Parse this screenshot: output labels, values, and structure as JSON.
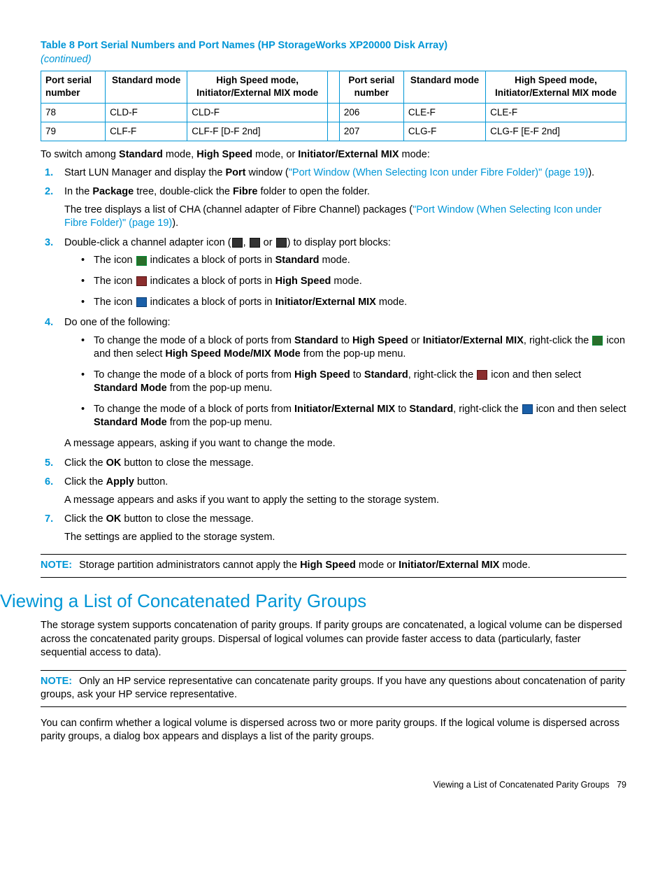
{
  "table": {
    "title": "Table 8 Port Serial Numbers and Port Names (HP StorageWorks XP20000 Disk Array)",
    "continued": "(continued)",
    "headers": {
      "h1": "Port serial number",
      "h2": "Standard mode",
      "h3": "High Speed mode, Initiator/External MIX mode",
      "h4": "Port serial number",
      "h5": "Standard mode",
      "h6": "High Speed mode, Initiator/External MIX mode"
    },
    "rows": [
      {
        "a": "78",
        "b": "CLD-F",
        "c": "CLD-F",
        "d": "206",
        "e": "CLE-F",
        "f": "CLE-F"
      },
      {
        "a": "79",
        "b": "CLF-F",
        "c": "CLF-F [D-F 2nd]",
        "d": "207",
        "e": "CLG-F",
        "f": "CLG-F [E-F 2nd]"
      }
    ]
  },
  "intro": {
    "pre": "To switch among ",
    "b1": "Standard",
    "t1": " mode, ",
    "b2": "High Speed",
    "t2": " mode, or ",
    "b3": "Initiator/External MIX",
    "t3": " mode:"
  },
  "step1": {
    "pre": "Start LUN Manager and display the ",
    "b1": "Port",
    "t1": " window (",
    "link": "\"Port Window (When Selecting Icon under Fibre Folder)\" (page 19)",
    "t2": ")."
  },
  "step2": {
    "a_pre": "In the ",
    "a_b1": "Package",
    "a_t1": " tree, double-click the ",
    "a_b2": "Fibre",
    "a_t2": " folder to open the folder.",
    "b_pre": "The tree displays a list of CHA (channel adapter of Fibre Channel) packages (",
    "b_link": "\"Port Window (When Selecting Icon under Fibre Folder)\" (page 19)",
    "b_post": ")."
  },
  "step3": {
    "pre": "Double-click a channel adapter icon (",
    "sep1": ", ",
    "sep2": " or ",
    "post": ") to display port blocks:",
    "bA_pre": "The icon ",
    "bA_mid": " indicates a block of ports in ",
    "bA_b": "Standard",
    "bA_post": " mode.",
    "bB_pre": "The icon ",
    "bB_mid": " indicates a block of ports in ",
    "bB_b": "High Speed",
    "bB_post": " mode.",
    "bC_pre": "The icon ",
    "bC_mid": " indicates a block of ports in ",
    "bC_b": "Initiator/External MIX",
    "bC_post": " mode."
  },
  "step4": {
    "lead": "Do one of the following:",
    "a_pre": "To change the mode of a block of ports from ",
    "a_b1": "Standard",
    "a_t1": " to ",
    "a_b2": "High Speed",
    "a_t2": " or ",
    "a_b3": "Initiator/External MIX",
    "a_t3": ", right-click the ",
    "a_t4": " icon and then select ",
    "a_b4": "High Speed Mode/MIX Mode",
    "a_t5": " from the pop-up menu.",
    "b_pre": "To change the mode of a block of ports from ",
    "b_b1": "High Speed",
    "b_t1": " to ",
    "b_b2": "Standard",
    "b_t2": ", right-click the ",
    "b_t3": " icon and then select ",
    "b_b3": "Standard Mode",
    "b_t4": " from the pop-up menu.",
    "c_pre": "To change the mode of a block of ports from ",
    "c_b1": "Initiator/External MIX",
    "c_t1": " to ",
    "c_b2": "Standard",
    "c_t2": ", right-click the ",
    "c_t3": " icon and then select ",
    "c_b3": "Standard Mode",
    "c_t4": " from the pop-up menu.",
    "tail": "A message appears, asking if you want to change the mode."
  },
  "step5": {
    "pre": "Click the ",
    "b": "OK",
    "post": " button to close the message."
  },
  "step6": {
    "pre": "Click the ",
    "b": "Apply",
    "post": " button.",
    "tail": "A message appears and asks if you want to apply the setting to the storage system."
  },
  "step7": {
    "pre": "Click the ",
    "b": "OK",
    "post": " button to close the message.",
    "tail": "The settings are applied to the storage system."
  },
  "note1": {
    "label": "NOTE:",
    "pre": "Storage partition administrators cannot apply the ",
    "b1": "High Speed",
    "t1": " mode or ",
    "b2": "Initiator/External MIX",
    "t2": " mode."
  },
  "section_heading": "Viewing a List of Concatenated Parity Groups",
  "para1": "The storage system supports concatenation of parity groups. If parity groups are concatenated, a logical volume can be dispersed across the concatenated parity groups. Dispersal of logical volumes can provide faster access to data (particularly, faster sequential access to data).",
  "note2": {
    "label": "NOTE:",
    "text": "Only an HP service representative can concatenate parity groups. If you have any questions about concatenation of parity groups, ask your HP service representative."
  },
  "para2": "You can confirm whether a logical volume is dispersed across two or more parity groups. If the logical volume is dispersed across parity groups, a dialog box appears and displays a list of the parity groups.",
  "footer": {
    "text": "Viewing a List of Concatenated Parity Groups",
    "page": "79"
  }
}
